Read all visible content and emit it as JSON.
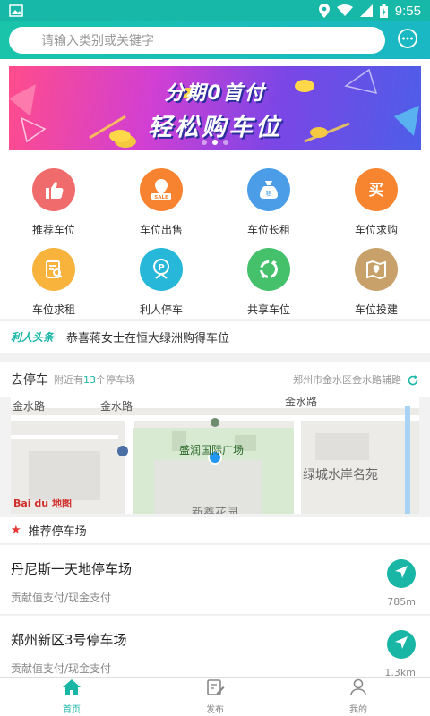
{
  "status_bar": {
    "time": "9:55"
  },
  "search": {
    "placeholder": "请输入类别或关键字"
  },
  "banner": {
    "line1": "分期0首付",
    "line2": "轻松购车位"
  },
  "categories": [
    {
      "label": "推荐车位",
      "color": "#f06b6b",
      "icon": "thumbs-up-icon"
    },
    {
      "label": "车位出售",
      "color": "#f7822f",
      "icon": "sale-tag-icon"
    },
    {
      "label": "车位长租",
      "color": "#4b9de8",
      "icon": "rent-bag-icon"
    },
    {
      "label": "车位求购",
      "color": "#f7852f",
      "icon": "buy-icon"
    },
    {
      "label": "车位求租",
      "color": "#f7b33c",
      "icon": "rent-doc-icon"
    },
    {
      "label": "利人停车",
      "color": "#27b7d8",
      "icon": "parking-icon"
    },
    {
      "label": "共享车位",
      "color": "#45c06b",
      "icon": "recycle-icon"
    },
    {
      "label": "车位投建",
      "color": "#c7a06a",
      "icon": "map-pin-icon"
    }
  ],
  "ticker": {
    "tag": "利人头条",
    "text": "恭喜蒋女士在恒大绿洲购得车位"
  },
  "parking": {
    "title": "去停车",
    "nearby_prefix": "附近有",
    "nearby_count": "13",
    "nearby_suffix": "个停车场",
    "address": "郑州市金水区金水路辅路"
  },
  "map": {
    "road1": "金水路",
    "road2": "金水路",
    "road3": "金水路",
    "poi1": "盛润国际广场",
    "poi2": "绿城水岸名苑",
    "poi3": "新鑫花园",
    "logo": "Bai du 地图"
  },
  "recommended": {
    "title": "推荐停车场"
  },
  "lots": [
    {
      "name": "丹尼斯一天地停车场",
      "pay": "贡献值支付/现金支付",
      "distance": "785m"
    },
    {
      "name": "郑州新区3号停车场",
      "pay": "贡献值支付/现金支付",
      "distance": "1.3km"
    }
  ],
  "tabs": [
    {
      "label": "首页",
      "active": true
    },
    {
      "label": "发布",
      "active": false
    },
    {
      "label": "我的",
      "active": false
    }
  ],
  "colors": {
    "primary": "#19b6a6",
    "header_start": "#19c4aa",
    "header_end": "#1ab7c4"
  }
}
